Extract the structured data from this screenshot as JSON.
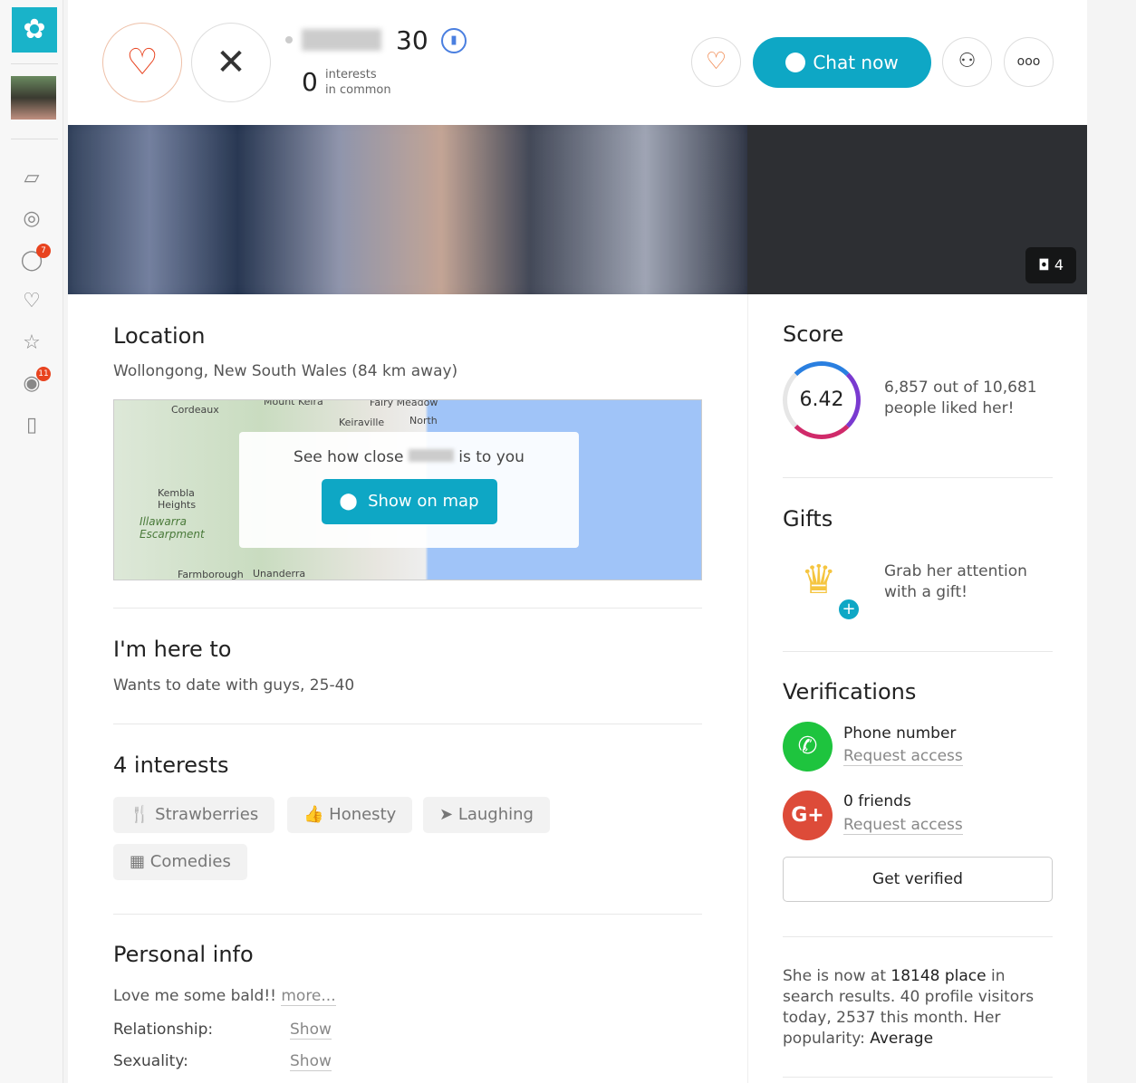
{
  "sidebar": {
    "badges": {
      "messages": "7",
      "visitors": "11"
    }
  },
  "header": {
    "age": "30",
    "interests_count": "0",
    "interests_line1": "interests",
    "interests_line2": "in common",
    "chat_label": "Chat now",
    "photo_count": "4"
  },
  "location": {
    "title": "Location",
    "text": "Wollongong, New South Wales (84 km away)",
    "map_prompt_before": "See how close",
    "map_prompt_after": "is to you",
    "map_button": "Show on map",
    "map_labels": [
      "Cordeaux",
      "Mount Keira",
      "Fairy Meadow",
      "Keiraville",
      "North",
      "Kembla Heights",
      "Illawarra Escarpment",
      "Farmborough",
      "Unanderra"
    ]
  },
  "here_to": {
    "title": "I'm here to",
    "text": "Wants to date with guys, 25-40"
  },
  "interests": {
    "title": "4 interests",
    "items": [
      "Strawberries",
      "Honesty",
      "Laughing",
      "Comedies"
    ]
  },
  "personal": {
    "title": "Personal info",
    "bio": "Love me some bald!!",
    "more": "more...",
    "rows": [
      {
        "label": "Relationship:",
        "value": "Show"
      },
      {
        "label": "Sexuality:",
        "value": "Show"
      }
    ]
  },
  "score": {
    "title": "Score",
    "value": "6.42",
    "line1": "6,857 out of 10,681",
    "line2": "people liked her!"
  },
  "gifts": {
    "title": "Gifts",
    "line1": "Grab her attention",
    "line2": "with a gift!"
  },
  "verifications": {
    "title": "Verifications",
    "phone": "Phone number",
    "phone_link": "Request access",
    "friends": "0 friends",
    "friends_link": "Request access",
    "button": "Get verified"
  },
  "stats": {
    "p1": "She is now at ",
    "place": "18148 place",
    "p2": " in search results. 40 profile visitors today, 2537 this month. Her popularity: ",
    "popularity": "Average"
  },
  "colors": {
    "accent": "#0ea7c5",
    "like": "#e8431f",
    "phone": "#1ec43e",
    "google": "#dd4b39"
  }
}
